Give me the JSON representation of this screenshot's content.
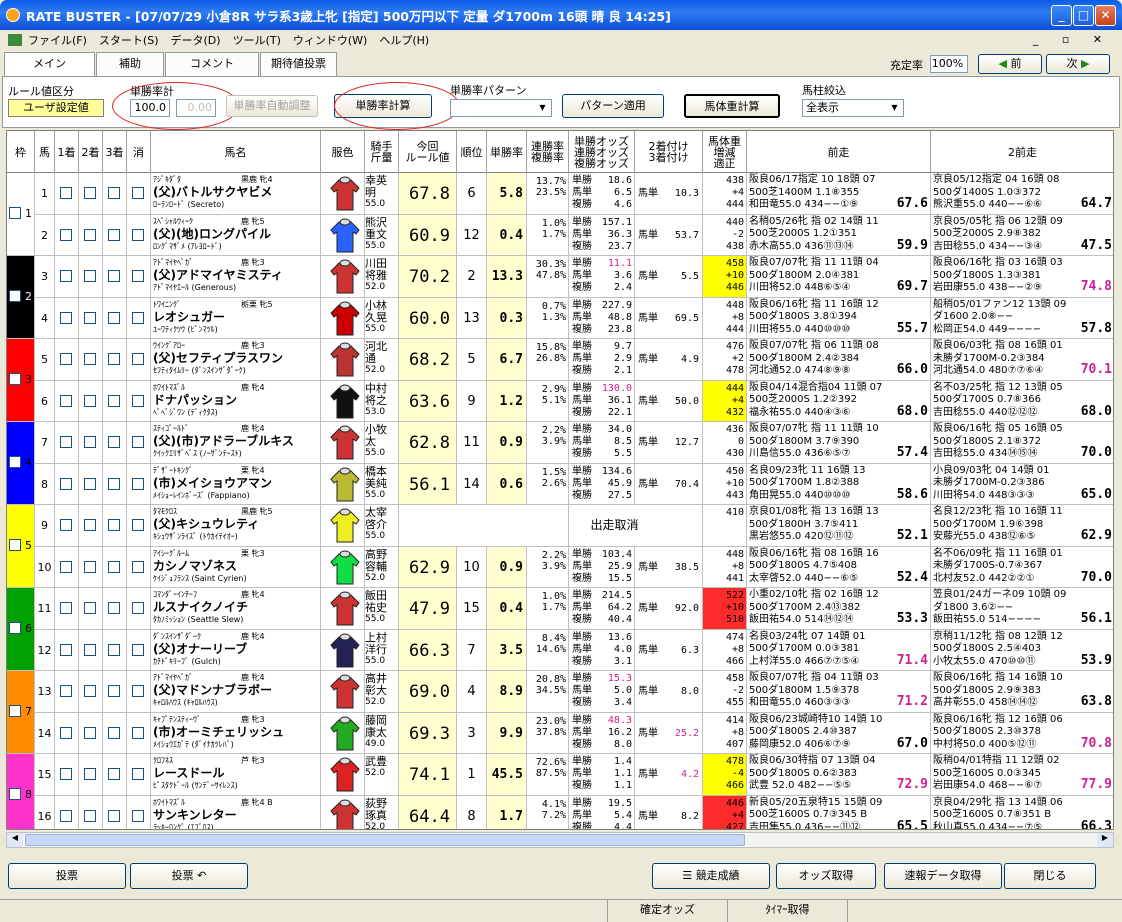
{
  "window": {
    "title": "RATE BUSTER - [07/07/29 小倉8R サラ系3歳上牝 [指定] 500万円以下 定量 ダ1700m  16頭 晴 良 14:25]"
  },
  "menu": [
    "ファイル(F)",
    "スタート(S)",
    "データ(D)",
    "ツール(T)",
    "ウィンドウ(W)",
    "ヘルプ(H)"
  ],
  "tabs": [
    "メイン",
    "補助",
    "コメント",
    "期待値投票"
  ],
  "topright": {
    "label": "充定率",
    "value": "100%",
    "prev": "前",
    "next": "次"
  },
  "controls": {
    "rule_label": "ルール値区分",
    "rule_value": "ユーザ設定値",
    "win_rate_label": "単勝率計",
    "win_rate_value": "100.0",
    "win_rate_value2": "0.00",
    "auto_adjust": "単勝率自動調整",
    "calc": "単勝率計算",
    "pattern_label": "単勝率パターン",
    "apply_pattern": "パターン適用",
    "weight_calc": "馬体重計算",
    "filter_label": "馬柱絞込",
    "filter_value": "全表示"
  },
  "headers": [
    "枠",
    "馬",
    "1着",
    "2着",
    "3着",
    "消",
    "馬名",
    "服色",
    "騎手\n斤量",
    "今回\nルール値",
    "順位",
    "単勝率",
    "連勝率\n複勝率",
    "単勝オッズ\n連勝オッズ\n複勝オッズ",
    "2着付け\n3着付け",
    "馬体重\n増減\n適正",
    "前走",
    "2前走"
  ],
  "colors": {
    "w1": "#ffffff",
    "w2": "#000000",
    "w3": "#ff0000",
    "w4": "#0000ff",
    "w5": "#ffff00",
    "w6": "#00a000",
    "w7": "#ff8c00",
    "w8": "#ff33cc"
  },
  "rows": [
    {
      "num": "1",
      "sire": "ｱｼﾞｷﾀﾞﾀ",
      "sex": "黒鹿 牝4",
      "name": "(父)バトルサクヤビメ",
      "dam": "ﾛｰﾗﾝﾛｰﾄﾞ (Secreto)",
      "jockey": "幸英明",
      "weight": "55.0",
      "rule": "67.8",
      "rank": "6",
      "win": "5.8",
      "r1": "13.7%",
      "r2": "23.5%",
      "o1": "18.6",
      "o2": "6.5",
      "o3": "4.6",
      "t2": "馬単",
      "t2v": "10.3",
      "bw": "438",
      "bd": "+4",
      "bb": "444",
      "p1a": "阪良06/17指定 10 18頭 07",
      "p1b": "500芝1400M 1.1⑧355",
      "p1c": "和田竜55.0 434−−①⑨",
      "p1r": "67.6",
      "p2a": "京良05/12指定 04 16頭 08",
      "p2b": "500ダ1400S 1.0③372",
      "p2c": "熊沢重55.0 440−−⑥⑥",
      "p2r": "64.7"
    },
    {
      "num": "2",
      "sire": "ｽﾍﾟｼｬﾙｳｨｰｸ",
      "sex": "鹿 牝5",
      "name": "(父)(地)ロングパイル",
      "dam": "ﾛﾝｸﾞﾏｻﾞﾒ (ｱﾚﾖﾛｰﾄﾞ)",
      "jockey": "熊沢重文",
      "weight": "55.0",
      "rule": "60.9",
      "rank": "12",
      "win": "0.4",
      "r1": "1.0%",
      "r2": "1.7%",
      "o1": "157.1",
      "o2": "36.3",
      "o3": "23.7",
      "t2": "馬単",
      "t2v": "53.7",
      "bw": "440",
      "bd": "-2",
      "bb": "438",
      "p1a": "名稍05/26牝 指 02 14頭 11",
      "p1b": "500芝2000S 1.2①351",
      "p1c": "赤木高55.0 436⑪⑬⑭",
      "p1r": "59.9",
      "p2a": "京良05/05牝 指 06 12頭 09",
      "p2b": "500芝2000S 2.9⑧382",
      "p2c": "吉田稔55.0 434−−③④",
      "p2r": "47.5"
    },
    {
      "num": "3",
      "sire": "ｱﾄﾞﾏｲﾔﾍﾞｶﾞ",
      "sex": "鹿 牝3",
      "name": "(父)アドマイヤミスティ",
      "dam": "ｱﾄﾞﾏｲﾔｴｰﾙ (Generous)",
      "jockey": "川田将雅",
      "weight": "52.0",
      "rule": "70.2",
      "rank": "2",
      "win": "13.3",
      "r1": "30.3%",
      "r2": "47.8%",
      "o1": "11.1",
      "o2": "3.6",
      "o3": "2.4",
      "t2": "馬単",
      "t2v": "5.5",
      "bw": "458",
      "bd": "+10",
      "bb": "446",
      "p1a": "阪良07/07牝 指 11 11頭 04",
      "p1b": "500ダ1800M 2.0④381",
      "p1c": "川田将52.0 448⑥⑤④",
      "p1r": "69.7",
      "p2a": "阪良06/16牝 指 03 16頭 03",
      "p2b": "500ダ1800S 1.3③381",
      "p2c": "岩田康55.0 438−−②⑨",
      "p2r": "74.8"
    },
    {
      "num": "4",
      "sire": "ﾄﾜｲﾆﾝｸﾞ",
      "sex": "栃栗 牝5",
      "name": "レオシュガー",
      "dam": "ﾕｰﾜﾃｨｸﾂｳ (ﾋﾟﾝﾏﾂﾙ)",
      "jockey": "小林久晃",
      "weight": "55.0",
      "rule": "60.0",
      "rank": "13",
      "win": "0.3",
      "r1": "0.7%",
      "r2": "1.3%",
      "o1": "227.9",
      "o2": "48.8",
      "o3": "23.8",
      "t2": "馬単",
      "t2v": "69.5",
      "bw": "448",
      "bd": "+8",
      "bb": "444",
      "p1a": "阪良06/16牝 指 11 16頭 12",
      "p1b": "500ダ1800S 3.8①394",
      "p1c": "川田将55.0 440⑩⑩⑩",
      "p1r": "55.7",
      "p2a": "船稍05/01ファン12 13頭 09",
      "p2b": "ダ1600 2.0⑧−−",
      "p2c": "松岡正54.0 449−−−−",
      "p2r": "57.8"
    },
    {
      "num": "5",
      "sire": "ｳｲﾝｸﾞｱﾛｰ",
      "sex": "鹿 牝3",
      "name": "(父)セフティプラスワン",
      "dam": "ｾﾌﾃｨﾀｲﾑﾘｰ (ﾀﾞﾝｽｲﾝｻﾞﾀﾞｰｸ)",
      "jockey": "河北通",
      "weight": "52.0",
      "rule": "68.2",
      "rank": "5",
      "win": "6.7",
      "r1": "15.8%",
      "r2": "26.8%",
      "o1": "9.7",
      "o2": "2.9",
      "o3": "2.1",
      "t2": "馬単",
      "t2v": "4.9",
      "bw": "476",
      "bd": "+2",
      "bb": "478",
      "p1a": "阪良07/07牝 指 06 11頭 08",
      "p1b": "500ダ1800M 2.4②384",
      "p1c": "河北通52.0 474⑧⑨⑧",
      "p1r": "66.0",
      "p2a": "阪良06/03牝 指 08 16頭 01",
      "p2b": "未勝ダ1700M-0.2③384",
      "p2c": "河北通54.0 480⑦⑦⑥④",
      "p2r": "70.1"
    },
    {
      "num": "6",
      "sire": "ﾎﾜｲﾄﾏｽﾞﾙ",
      "sex": "鹿 牝4",
      "name": "ドナパッション",
      "dam": "ﾍﾟﾍﾞｼﾞﾜﾝ (ﾃﾞｨｸﾀｽ)",
      "jockey": "中村将之",
      "weight": "53.0",
      "rule": "63.6",
      "rank": "9",
      "win": "1.2",
      "r1": "2.9%",
      "r2": "5.1%",
      "o1": "130.0",
      "o2": "36.1",
      "o3": "22.1",
      "t2": "馬単",
      "t2v": "50.0",
      "bw": "444",
      "bd": "+4",
      "bb": "432",
      "p1a": "阪良04/14混合指04 11頭 07",
      "p1b": "500芝2000S 1.2②392",
      "p1c": "福永祐55.0 440④③⑥",
      "p1r": "68.0",
      "p2a": "名不03/25牝 指 12 13頭 05",
      "p2b": "500ダ1700S 0.7⑧366",
      "p2c": "吉田稔55.0 440⑫⑫⑫",
      "p2r": "68.0"
    },
    {
      "num": "7",
      "sire": "ｽﾃｨｺﾞｰﾙﾄﾞ",
      "sex": "鹿 牝4",
      "name": "(父)(市)アドラーブルキス",
      "dam": "ｸｲｯｸｴﾘｻﾞﾍﾞｽ (ﾉｰｻﾞﾝﾃｰｽﾄ)",
      "jockey": "小牧太",
      "weight": "55.0",
      "rule": "62.8",
      "rank": "11",
      "win": "0.9",
      "r1": "2.2%",
      "r2": "3.9%",
      "o1": "34.0",
      "o2": "8.5",
      "o3": "5.5",
      "t2": "馬単",
      "t2v": "12.7",
      "bw": "436",
      "bd": "0",
      "bb": "430",
      "p1a": "阪良07/07牝 指 11 11頭 10",
      "p1b": "500ダ1800M 3.7⑨390",
      "p1c": "川島信55.0 436⑥⑤⑦",
      "p1r": "57.4",
      "p2a": "阪良06/16牝 指 05 16頭 05",
      "p2b": "500ダ1800S 2.1⑧372",
      "p2c": "吉田稔55.0 434⑭⑮⑭",
      "p2r": "70.0"
    },
    {
      "num": "8",
      "sire": "ﾃﾞｻﾞｰﾄｷﾝｸﾞ",
      "sex": "栗 牝4",
      "name": "(市)メイショウアマン",
      "dam": "ﾒｲｼｮｰﾚｲﾝﾎﾞｰｽﾞ (Fappiano)",
      "jockey": "橋本美純",
      "weight": "55.0",
      "rule": "56.1",
      "rank": "14",
      "win": "0.6",
      "r1": "1.5%",
      "r2": "2.6%",
      "o1": "134.6",
      "o2": "45.9",
      "o3": "27.5",
      "t2": "馬単",
      "t2v": "70.4",
      "bw": "450",
      "bd": "+10",
      "bb": "443",
      "p1a": "名良09/23牝 11 16頭 13",
      "p1b": "500ダ1700M 1.8②388",
      "p1c": "角田晃55.0 440⑩⑩⑩",
      "p1r": "58.6",
      "p2a": "小良09/03牝 04 14頭 01",
      "p2b": "未勝ダ1700M-0.2③386",
      "p2c": "川田将54.0 448③③③",
      "p2r": "65.0"
    },
    {
      "num": "9",
      "sire": "ﾀﾏﾓｸﾛｽ",
      "sex": "黒鹿 牝5",
      "name": "(父)キシュウレティ",
      "dam": "ｷｼｭｳｻﾞﾝﾗｲｽﾞ (ﾄｳｶｲﾃｲｵｰ)",
      "jockey": "太宰啓介",
      "weight": "55.0",
      "rule": "",
      "rank": "",
      "win": "",
      "scratch": "出走取消",
      "bw": "",
      "bd": "",
      "bb": "410",
      "p1a": "京良01/08牝 指 13 16頭 13",
      "p1b": "500ダ1800H 3.7⑤411",
      "p1c": "黒岩悠55.0 420⑫⑪⑫",
      "p1r": "52.1",
      "p2a": "名良12/23牝 指 10 16頭 11",
      "p2b": "500ダ1700M 1.9⑥398",
      "p2c": "安藤光55.0 438⑫⑥⑤",
      "p2r": "62.9"
    },
    {
      "num": "10",
      "sire": "ｱｲｼｰｸﾞﾙｰﾑ",
      "sex": "栗 牝3",
      "name": "カシノマゾネス",
      "dam": "ｹｲｼﾞｮﾌﾗﾝｽ (Saint Cyrien)",
      "jockey": "高野容輔",
      "weight": "52.0",
      "rule": "62.9",
      "rank": "10",
      "win": "0.9",
      "r1": "2.2%",
      "r2": "3.9%",
      "o1": "103.4",
      "o2": "25.9",
      "o3": "15.5",
      "t2": "馬単",
      "t2v": "38.5",
      "bw": "448",
      "bd": "+8",
      "bb": "441",
      "p1a": "阪良06/16牝 指 08 16頭 16",
      "p1b": "500ダ1800S 4.7⑤408",
      "p1c": "太宰啓52.0 440−−⑥⑤",
      "p1r": "52.4",
      "p2a": "名不06/09牝 指 11 16頭 01",
      "p2b": "未勝ダ1700S-0.7④367",
      "p2c": "北村友52.0 442②②①",
      "p2r": "70.0"
    },
    {
      "num": "11",
      "sire": "ｺﾏﾝﾀﾞｰｲﾝﾁｰﾌ",
      "sex": "鹿 牝4",
      "name": "ルスナイクノイチ",
      "dam": "ﾀｶﾉﾐｯｼｮﾝ (Seattle Slew)",
      "jockey": "飯田祐史",
      "weight": "55.0",
      "rule": "47.9",
      "rank": "15",
      "win": "0.4",
      "r1": "1.0%",
      "r2": "1.7%",
      "o1": "214.5",
      "o2": "64.2",
      "o3": "40.4",
      "t2": "馬単",
      "t2v": "92.0",
      "bw": "522",
      "bd": "+10",
      "bb": "510",
      "p1a": "小重02/10牝 指 02 16頭 12",
      "p1b": "500ダ1700M 2.4⑬382",
      "p1c": "飯田祐54.0 514⑭⑫⑭",
      "p1r": "53.3",
      "p2a": "笠良01/24ガーネ09 10頭 09",
      "p2b": "ダ1800 3.6②−−",
      "p2c": "飯田祐55.0 514−−−−",
      "p2r": "56.1"
    },
    {
      "num": "12",
      "sire": "ﾀﾞﾝｽｲﾝｻﾞﾀﾞｰｸ",
      "sex": "鹿 牝4",
      "name": "(父)オナーリーブ",
      "dam": "ｶﾁﾄﾞｷﾘｰﾌﾞ (Gulch)",
      "jockey": "上村洋行",
      "weight": "55.0",
      "rule": "66.3",
      "rank": "7",
      "win": "3.5",
      "r1": "8.4%",
      "r2": "14.6%",
      "o1": "13.6",
      "o2": "4.0",
      "o3": "3.1",
      "t2": "馬単",
      "t2v": "6.3",
      "bw": "474",
      "bd": "+8",
      "bb": "466",
      "p1a": "名良03/24牝 07 14頭 01",
      "p1b": "500ダ1700M 0.0③381",
      "p1c": "上村洋55.0 466⑦⑦⑤④",
      "p1r": "71.4",
      "p2a": "京稍11/12牝 指 08 12頭 12",
      "p2b": "500ダ1800S 2.5④403",
      "p2c": "小牧太55.0 470⑩⑩⑪",
      "p2r": "53.9"
    },
    {
      "num": "13",
      "sire": "ｱﾄﾞﾏｲﾔﾍﾞｶﾞ",
      "sex": "鹿 牝4",
      "name": "(父)マドンナブラボー",
      "dam": "ｷｬﾛﾙﾊｳｽ (ｷｬﾛﾙﾊｳｽ)",
      "jockey": "高井彰大",
      "weight": "52.0",
      "rule": "69.0",
      "rank": "4",
      "win": "8.9",
      "r1": "20.8%",
      "r2": "34.5%",
      "o1": "15.3",
      "o2": "5.0",
      "o3": "3.4",
      "t2": "馬単",
      "t2v": "8.0",
      "bw": "458",
      "bd": "-2",
      "bb": "455",
      "p1a": "阪良07/07牝 指 04 11頭 03",
      "p1b": "500ダ1800M 1.5⑨378",
      "p1c": "和田竜55.0 460③③③",
      "p1r": "71.2",
      "p2a": "阪良06/16牝 指 14 16頭 10",
      "p2b": "500ダ1800S 2.9⑨383",
      "p2c": "高井彰55.0 458⑭⑭⑫",
      "p2r": "63.8"
    },
    {
      "num": "14",
      "sire": "ｷｬﾌﾟﾃﾝｽﾃｨｰｳﾞ",
      "sex": "鹿 牝3",
      "name": "(市)オーミチェリッシュ",
      "dam": "ﾒｲｼｮｳｴｶﾞﾃ (ﾀﾞｲﾅｶﾂﾚﾊﾞ)",
      "jockey": "藤岡康太",
      "weight": "49.0",
      "rule": "69.3",
      "rank": "3",
      "win": "9.9",
      "r1": "23.0%",
      "r2": "37.8%",
      "o1": "48.3",
      "o2": "16.2",
      "o3": "8.0",
      "t2": "馬単",
      "t2v": "25.2",
      "bw": "414",
      "bd": "+8",
      "bb": "407",
      "p1a": "阪良06/23城崎特10 14頭 10",
      "p1b": "500ダ1800S 2.4⑩387",
      "p1c": "藤岡康52.0 406⑥⑦⑨",
      "p1r": "67.0",
      "p2a": "阪良06/16牝 指 12 16頭 06",
      "p2b": "500ダ1800S 2.3⑩378",
      "p2c": "中村将50.0 400⑤⑫⑪",
      "p2r": "70.8"
    },
    {
      "num": "15",
      "sire": "ｸﾛﾌﾈｽ",
      "sex": "芦 牝3",
      "name": "レースドール",
      "dam": "ﾋﾟｽﾀｸﾄﾞｰﾙ (ｻﾝﾃﾞｰｻｲﾚﾝｽ)",
      "jockey": "武豊",
      "weight": "52.0",
      "rule": "74.1",
      "rank": "1",
      "win": "45.5",
      "r1": "72.6%",
      "r2": "87.5%",
      "o1": "1.4",
      "o2": "1.1",
      "o3": "1.1",
      "t2": "馬単",
      "t2v": "4.2",
      "bw": "478",
      "bd": "-4",
      "bb": "466",
      "p1a": "阪良06/30特指 07 13頭 04",
      "p1b": "500ダ1800S 0.6②383",
      "p1c": "武豊 52.0 482−−⑤⑤",
      "p1r": "72.9",
      "p2a": "阪稍04/01特指 11 12頭 02",
      "p2b": "500芝1600S 0.0③345",
      "p2c": "岩田康54.0 468−−⑥⑦",
      "p2r": "77.9"
    },
    {
      "num": "16",
      "sire": "ﾎﾜｲﾄﾏｽﾞﾙ",
      "sex": "鹿 牝4 B",
      "name": "サンキンレター",
      "dam": "ﾗｯｷｰﾛﾝｸﾞ (ｴﾌﾞﾛｽ)",
      "jockey": "荻野琢真",
      "weight": "52.0",
      "rule": "64.4",
      "rank": "8",
      "win": "1.7",
      "r1": "4.1%",
      "r2": "7.2%",
      "o1": "19.5",
      "o2": "5.4",
      "o3": "4.4",
      "t2": "馬単",
      "t2v": "8.2",
      "bw": "446",
      "bd": "+4",
      "bb": "427",
      "p1a": "新良05/20五泉特15 15頭 09",
      "p1b": "500芝1600S 0.7③345 B",
      "p1c": "吉田隼55.0 436−−⑪⑫",
      "p1r": "65.5",
      "p2a": "京良04/29牝 指 13 14頭 06",
      "p2b": "500芝1600S 0.7⑧351 B",
      "p2c": "秋山真55.0 434−−⑦⑤",
      "p2r": "66.3"
    }
  ],
  "bottom": {
    "vote1": "投票",
    "vote2": "投票",
    "results": "競走成績",
    "odds": "オッズ取得",
    "quick": "速報データ取得",
    "close": "閉じる"
  },
  "status": {
    "s1": "確定オッズ",
    "s2": "ﾀｲﾏｰ取得"
  }
}
